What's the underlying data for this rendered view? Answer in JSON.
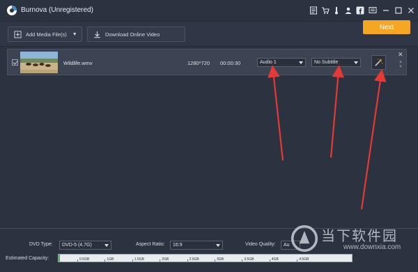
{
  "window": {
    "title": "Burnova (Unregistered)"
  },
  "titlebar_icons": [
    "register-icon",
    "cart-icon",
    "thermometer-icon",
    "user-icon",
    "facebook-icon",
    "feedback-icon",
    "minimize-icon",
    "maximize-icon",
    "close-icon"
  ],
  "toolbar": {
    "add_media_label": "Add Media File(s)",
    "download_label": "Download Online Video"
  },
  "file": {
    "name": "Wildlife.wmv",
    "resolution": "1280*720",
    "duration": "00:00:30",
    "audio": "Audio 1",
    "subtitle": "No Subtitle"
  },
  "settings": {
    "dvd_type_label": "DVD Type:",
    "dvd_type_value": "DVD-5 (4.7G)",
    "aspect_label": "Aspect Ratio:",
    "aspect_value": "16:9",
    "quality_label": "Video Quality:",
    "quality_value": "Au",
    "capacity_label": "Estimated Capacity:",
    "capacity_used_fraction": 0.005,
    "capacity_ticks": [
      "0.5GB",
      "1GB",
      "1.5GB",
      "2GB",
      "2.5GB",
      "3GB",
      "3.5GB",
      "4GB",
      "4.5GB"
    ]
  },
  "next_label": "Next",
  "watermark": {
    "text": "当下软件园",
    "url": "www.downxia.com"
  },
  "colors": {
    "accent": "#f5a623",
    "annotation": "#e53935",
    "capacity_fill": "#4caf50"
  }
}
